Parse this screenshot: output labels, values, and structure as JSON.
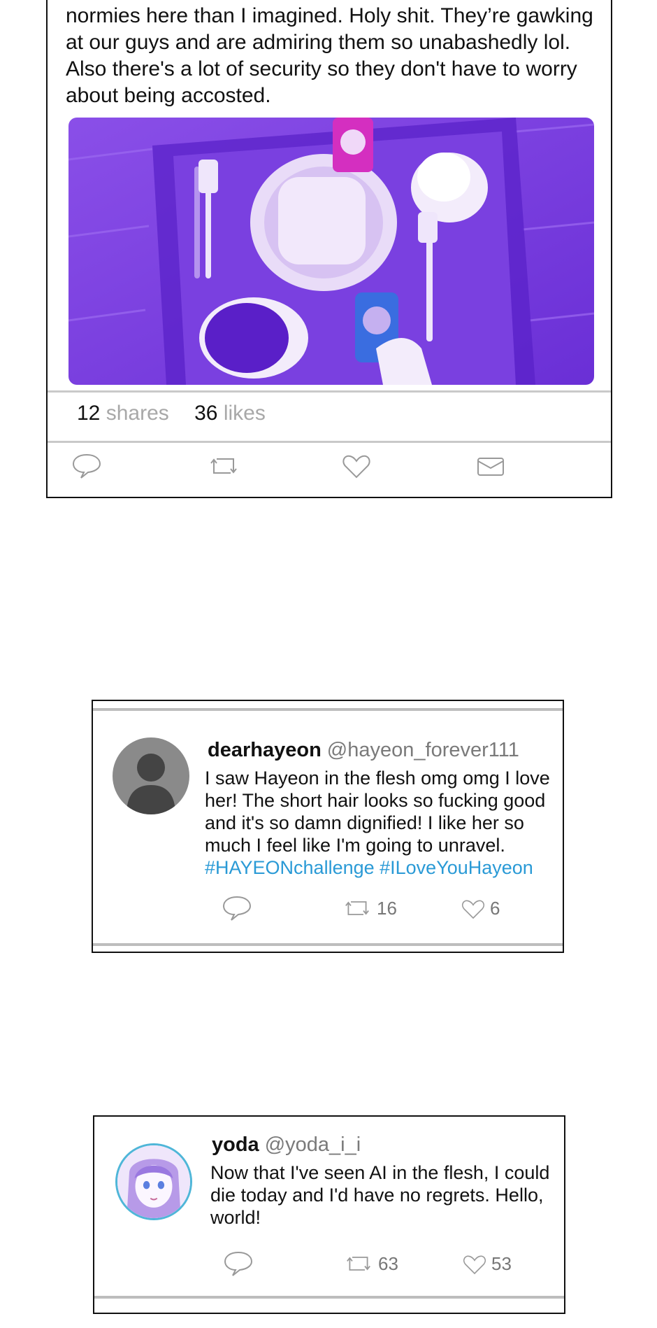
{
  "post1": {
    "text": "normies here than I imagined. Holy shit. They’re gawking at our guys and are admiring them so unabashedly lol. Also there's a lot of security so they don't have to worry about being accosted.",
    "shares_count": "12",
    "shares_label": "shares",
    "likes_count": "36",
    "likes_label": "likes",
    "actions": [
      "comment-icon",
      "retweet-icon",
      "heart-icon",
      "message-icon"
    ]
  },
  "post2": {
    "display_name": "dearhayeon",
    "handle": "@hayeon_forever111",
    "body": "I saw Hayeon in the flesh omg omg I love her! The short hair looks so fucking good and it's so damn dignified! I like her so much I feel like I'm going to unravel.",
    "hashtags": "#HAYEONchallenge #ILoveYouHayeon",
    "retweets": "16",
    "likes": "6"
  },
  "post3": {
    "display_name": "yoda",
    "handle": "@yoda_i_i",
    "body": "Now that I've seen AI in the flesh, I could die today and I'd have no regrets. Hello, world!",
    "retweets": "63",
    "likes": "53"
  },
  "colors": {
    "hashtag": "#2a9ad6",
    "muted": "#a8a8a8",
    "image_tint": "#7b3fe0"
  }
}
